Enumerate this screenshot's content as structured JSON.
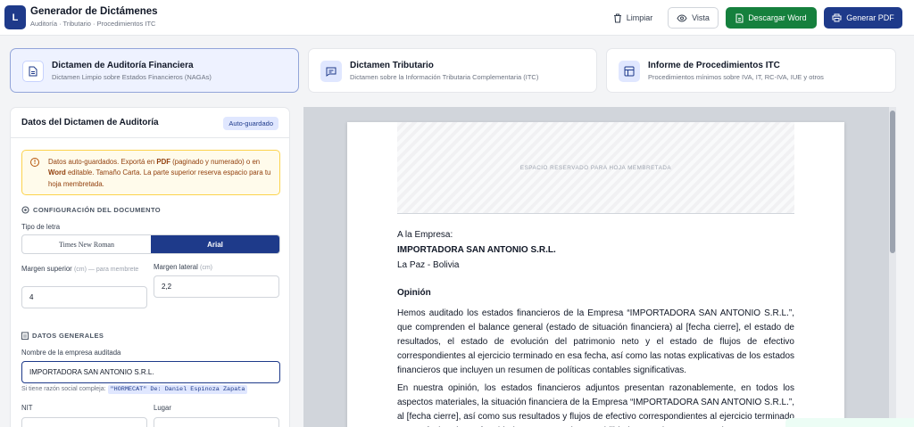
{
  "header": {
    "logo_letter": "L",
    "title": "Generador de Dictámenes",
    "subtitle": "Auditoría · Tributario · Procedimientos ITC",
    "buttons": {
      "clear": "Limpiar",
      "view": "Vista",
      "word": "Descargar Word",
      "pdf": "Generar PDF"
    }
  },
  "tabs": [
    {
      "title": "Dictamen de Auditoría Financiera",
      "subtitle": "Dictamen Limpio sobre Estados Financieros (NAGAs)",
      "active": true,
      "icon": "document-icon"
    },
    {
      "title": "Dictamen Tributario",
      "subtitle": "Dictamen sobre la Información Tributaria Complementaria (ITC)",
      "active": false,
      "icon": "message-icon"
    },
    {
      "title": "Informe de Procedimientos ITC",
      "subtitle": "Procedimientos mínimos sobre IVA, IT, RC-IVA, IUE y otros",
      "active": false,
      "icon": "layout-icon"
    }
  ],
  "form": {
    "title": "Datos del Dictamen de Auditoría",
    "badge": "Auto-guardado",
    "alert": {
      "p1": "Datos auto-guardados. Exportá en ",
      "b1": "PDF",
      "p2": " (paginado y numerado) o en ",
      "b2": "Word",
      "p3": " editable. Tamaño Carta. La parte superior reserva espacio para tu hoja membretada."
    },
    "config_section": "CONFIGURACIÓN DEL DOCUMENTO",
    "font_label": "Tipo de letra",
    "font_options": [
      "Times New Roman",
      "Arial"
    ],
    "font_selected": "Arial",
    "margin_top_label": "Margen superior",
    "margin_top_hint": "(cm) — para membrete",
    "margin_top_value": "4",
    "margin_side_label": "Margen lateral",
    "margin_side_hint": "(cm)",
    "margin_side_value": "2,2",
    "general_section": "DATOS GENERALES",
    "company_label": "Nombre de la empresa auditada",
    "company_value": "IMPORTADORA SAN ANTONIO S.R.L.",
    "company_hint": "Si tiene razón social compleja:",
    "company_hint_code": "\"HORMECAT\" De: Daniel Espinoza Zapata",
    "nit_label": "NIT",
    "lugar_label": "Lugar"
  },
  "preview": {
    "letterhead": "ESPACIO RESERVADO PARA HOJA MEMBRETADA",
    "to": "A la Empresa:",
    "company": "IMPORTADORA SAN ANTONIO S.R.L.",
    "place": "La Paz - Bolivia",
    "heading": "Opinión",
    "p1": "Hemos auditado los estados financieros de la Empresa “IMPORTADORA SAN ANTONIO S.R.L.”, que comprenden el balance general (estado de situación financiera) al [fecha cierre], el estado de resultados, el estado de evolución del patrimonio neto y el estado de flujos de efectivo correspondientes al ejercicio terminado en esa fecha, así como las notas explicativas de los estados financieros que incluyen un resumen de políticas contables significativas.",
    "p2": "En nuestra opinión, los estados financieros adjuntos presentan razonablemente, en todos los aspectos materiales, la situación financiera de la Empresa “IMPORTADORA SAN ANTONIO S.R.L.”, al [fecha cierre], así como sus resultados y flujos de efectivo correspondientes al ejercicio terminado en esa fecha, de conformidad con Normas de Contabilidad Generalmente Aceptadas"
  },
  "colors": {
    "primary": "#1e3a8a",
    "success": "#15803d",
    "warning_bg": "#fffbeb"
  }
}
